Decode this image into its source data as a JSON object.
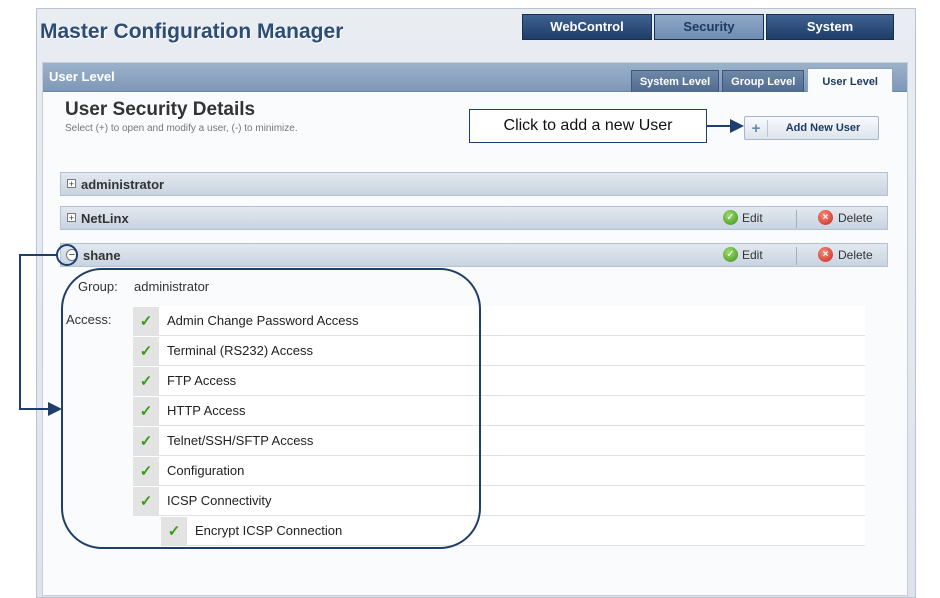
{
  "app_title": "Master Configuration Manager",
  "top_tabs": [
    {
      "label": "WebControl"
    },
    {
      "label": "Security"
    },
    {
      "label": "System"
    }
  ],
  "panel": {
    "header_title": "User Level",
    "sub_tabs": [
      {
        "label": "System Level"
      },
      {
        "label": "Group Level"
      },
      {
        "label": "User Level"
      }
    ],
    "section_title": "User Security Details",
    "section_subtitle": "Select (+) to open and modify a user, (-) to minimize.",
    "add_button_label": "Add New User",
    "add_button_plus": "+"
  },
  "callout": {
    "text": "Click to add a new User"
  },
  "users": [
    {
      "name": "administrator",
      "expander": "+"
    },
    {
      "name": "NetLinx",
      "expander": "+",
      "edit_label": "Edit",
      "delete_label": "Delete"
    },
    {
      "name": "shane",
      "expander": "−",
      "edit_label": "Edit",
      "delete_label": "Delete"
    }
  ],
  "details": {
    "group_label": "Group:",
    "group_value": "administrator",
    "access_label": "Access:",
    "access_items": [
      "Admin Change Password Access",
      "Terminal (RS232) Access",
      "FTP Access",
      "HTTP Access",
      "Telnet/SSH/SFTP Access",
      "Configuration",
      "ICSP Connectivity"
    ],
    "nested_item": "Encrypt ICSP Connection",
    "check_glyph": "✓"
  },
  "colors": {
    "brand_dark": "#1f3e6e",
    "check_green": "#3a9a1a",
    "delete_red": "#c0281c"
  }
}
